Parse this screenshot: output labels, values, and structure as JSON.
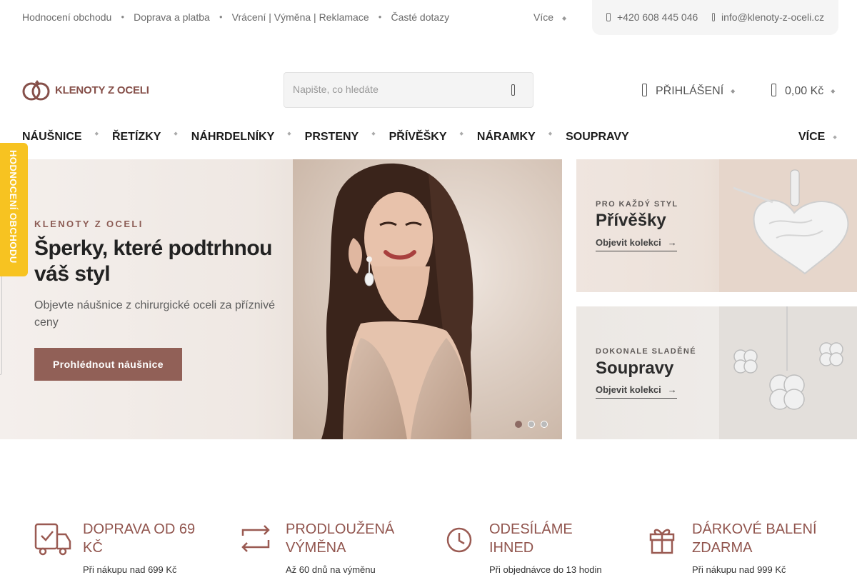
{
  "topbar": {
    "links": [
      "Hodnocení obchodu",
      "Doprava a platba",
      "Vrácení | Výměna | Reklamace",
      "Časté dotazy"
    ],
    "more": "Více",
    "phone": "+420 608 445 046",
    "email": "info@klenoty-z-oceli.cz"
  },
  "header": {
    "logo_text": "KLENOTY Z OCELI",
    "search_placeholder": "Napište, co hledáte",
    "login": "PŘIHLÁŠENÍ",
    "cart": "0,00 Kč"
  },
  "nav": {
    "items": [
      "NÁUŠNICE",
      "ŘETÍZKY",
      "NÁHRDELNÍKY",
      "PRSTENY",
      "PŘÍVĚŠKY",
      "NÁRAMKY",
      "SOUPRAVY"
    ],
    "more": "VÍCE"
  },
  "rating_tab": "HODNOCENÍ OBCHODU",
  "hero": {
    "eyebrow": "KLENOTY Z OCELI",
    "title": "Šperky, které podtrhnou váš styl",
    "subtitle": "Objevte náušnice z chirurgické oceli za příznivé ceny",
    "button": "Prohlédnout náušnice",
    "slides_active": 1,
    "slides_total": 3
  },
  "cards": [
    {
      "eyebrow": "PRO KAŽDÝ STYL",
      "title": "Přívěšky",
      "link": "Objevit kolekci",
      "arrow": "→"
    },
    {
      "eyebrow": "DOKONALE SLADĚNÉ",
      "title": "Soupravy",
      "link": "Objevit kolekci",
      "arrow": "→"
    }
  ],
  "features": [
    {
      "title": "DOPRAVA OD 69 KČ",
      "sub": "Při nákupu nad 699 Kč",
      "icon": "truck-check-icon"
    },
    {
      "title": "PRODLOUŽENÁ VÝMĚNA",
      "sub": "Až 60 dnů na výměnu",
      "icon": "exchange-arrows-icon"
    },
    {
      "title": "ODESÍLÁME IHNED",
      "sub": "Při objednávce do 13 hodin",
      "icon": "clock-icon"
    },
    {
      "title": "DÁRKOVÉ BALENÍ ZDARMA",
      "sub": "Při nákupu nad 999 Kč",
      "icon": "gift-icon"
    }
  ],
  "colors": {
    "brand": "#916057",
    "rating_tab": "#f7c321",
    "feature_title": "#91554e"
  }
}
